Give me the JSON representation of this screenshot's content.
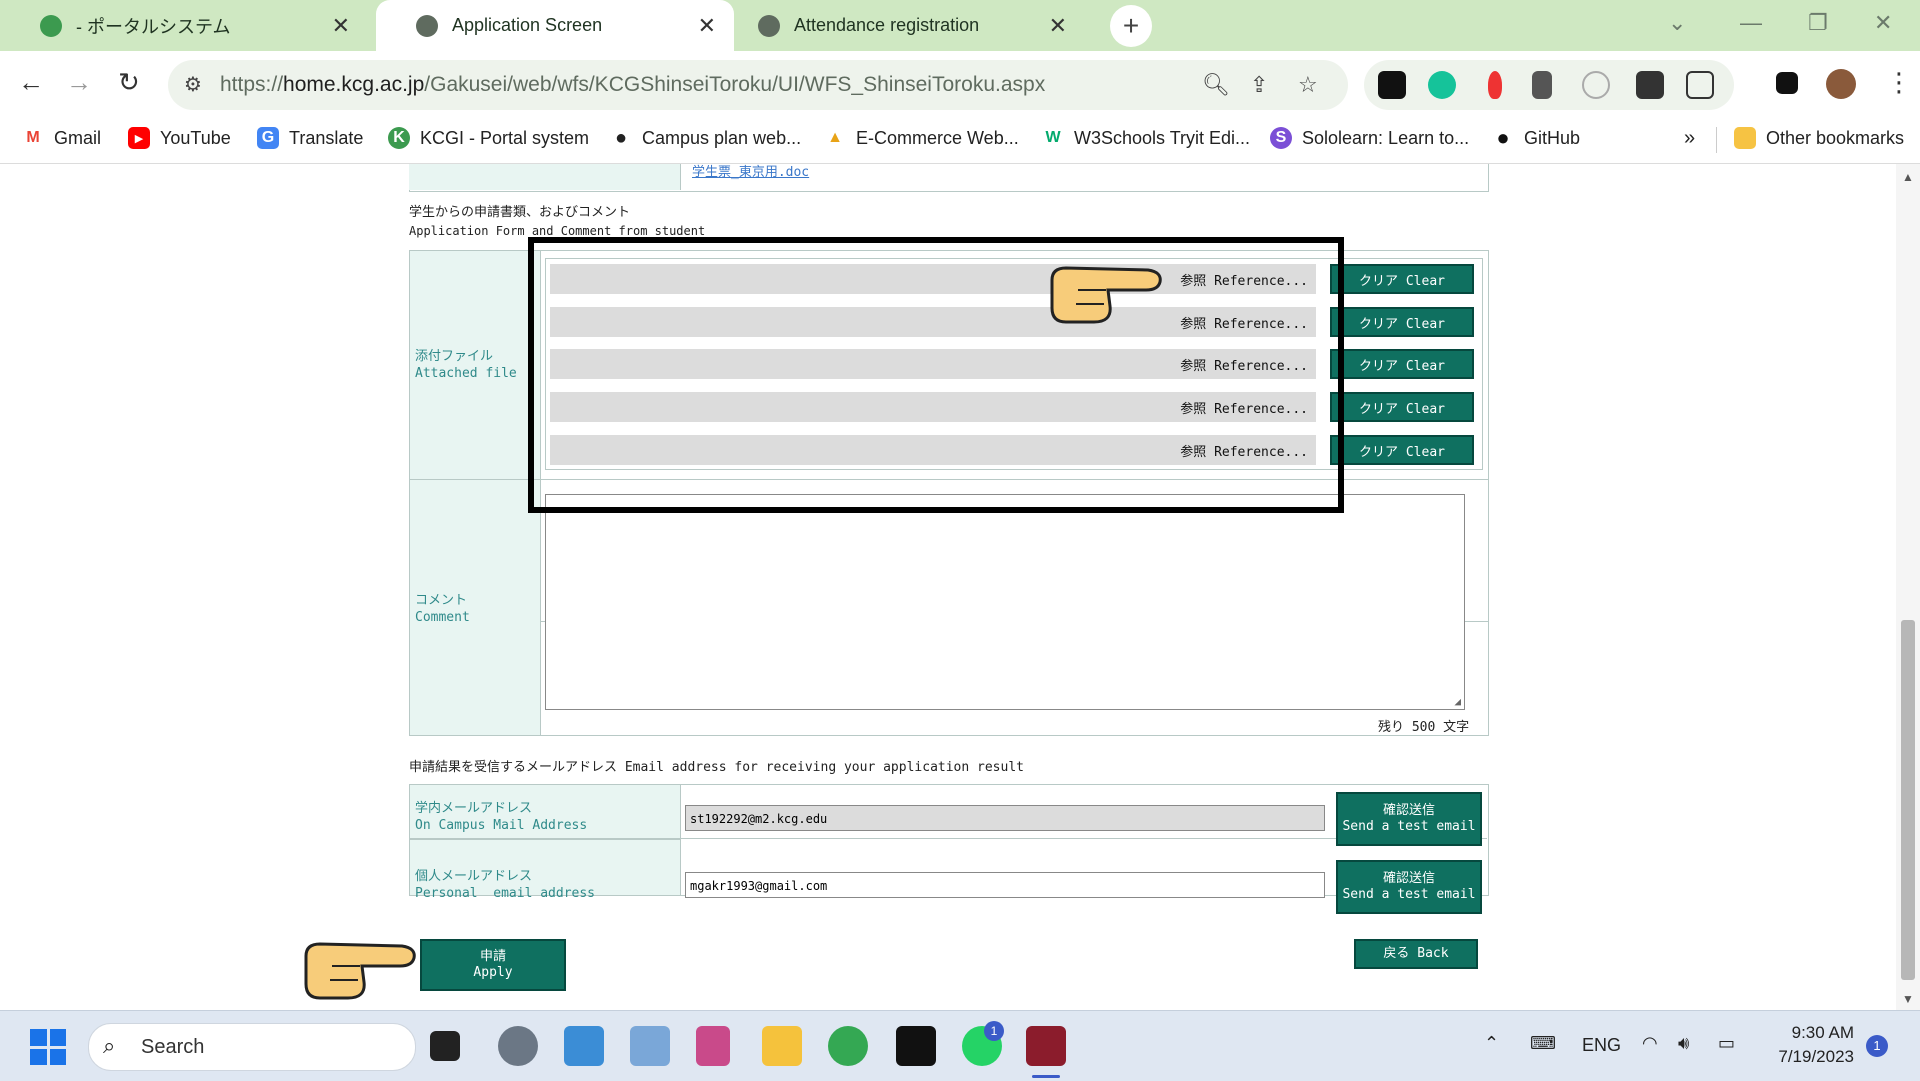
{
  "browser": {
    "tabs": [
      {
        "label": " - ポータルシステム"
      },
      {
        "label": "Application Screen"
      },
      {
        "label": "Attendance registration"
      }
    ],
    "url_scheme": "https://",
    "url_host": "home.kcg.ac.jp",
    "url_path": "/Gakusei/web/wfs/KCGShinseiToroku/UI/WFS_ShinseiToroku.aspx",
    "bookmarks": [
      {
        "label": "Gmail",
        "color": "#ea4335",
        "glyph": "M"
      },
      {
        "label": "YouTube",
        "color": "#ff0000",
        "glyph": "▶"
      },
      {
        "label": "Translate",
        "color": "#4285f4",
        "glyph": "G"
      },
      {
        "label": "KCGI - Portal system",
        "color": "#3c9a4f",
        "glyph": "K"
      },
      {
        "label": "Campus plan web...",
        "color": "#222222",
        "glyph": "●"
      },
      {
        "label": "E-Commerce Web...",
        "color": "#e8a317",
        "glyph": "▲"
      },
      {
        "label": "W3Schools Tryit Edi...",
        "color": "#04aa6d",
        "glyph": "W"
      },
      {
        "label": "Sololearn: Learn to...",
        "color": "#7b4fd6",
        "glyph": "S"
      },
      {
        "label": "GitHub",
        "color": "#111111",
        "glyph": "●"
      }
    ],
    "more_bookmarks": "»",
    "other_bookmarks": "Other bookmarks"
  },
  "form": {
    "top_link": "学生票_東京用.doc",
    "section_title_jp": "学生からの申請書類、およびコメント",
    "section_title_en": "Application Form and Comment from student",
    "attached_label_jp": "添付ファイル",
    "attached_label_en": "Attached file",
    "reference_label": "参照 Reference...",
    "clear_label": "クリア Clear",
    "comment_label_jp": "コメント",
    "comment_label_en": "Comment",
    "remaining": "残り 500 文字",
    "email_section_title": "申請結果を受信するメールアドレス Email address for receiving your application result",
    "campus_label_jp": "学内メールアドレス",
    "campus_label_en": "On Campus Mail Address",
    "campus_email": "st192292@m2.kcg.edu",
    "personal_label_jp": "個人メールアドレス",
    "personal_label_en": "Personal  email address",
    "personal_email": "mgakr1993@gmail.com",
    "test_email_jp": "確認送信",
    "test_email_en": "Send a test email",
    "apply_jp": "申請",
    "apply_en": "Apply",
    "back_label": "戻る Back"
  },
  "taskbar": {
    "search_placeholder": "Search",
    "language": "ENG",
    "time": "9:30 AM",
    "date": "7/19/2023",
    "notification_count": "1",
    "whatsapp_badge": "1"
  },
  "colors": {
    "tabstrip": "#cfe8c2",
    "teal_button": "#0f7060",
    "label_text": "#2f8a8a",
    "label_cell": "#e8f5f2"
  }
}
